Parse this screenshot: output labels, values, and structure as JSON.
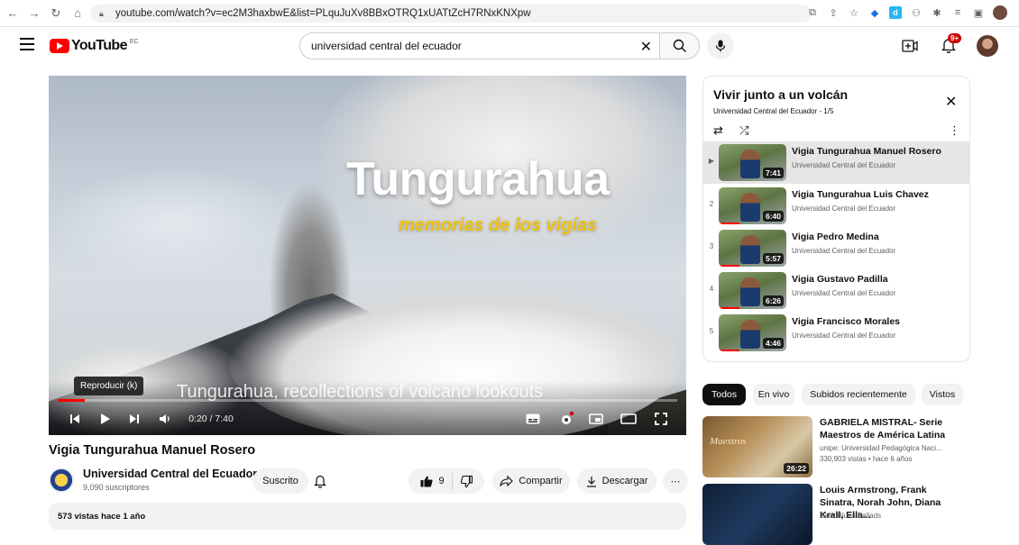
{
  "browser": {
    "url": "youtube.com/watch?v=ec2M3haxbwE&list=PLquJuXv8BBxOTRQ1xUATtZcH7RNxKNXpw"
  },
  "masthead": {
    "logo_text": "YouTube",
    "country": "EC",
    "search_value": "universidad central del ecuador",
    "notif_count": "9+"
  },
  "player": {
    "overlay_title": "Tungurahua",
    "overlay_subtitle": "memorias de los vigías",
    "caption": "Tungurahua, recollections of volcano lookouts",
    "tooltip": "Reproducir (k)",
    "time": "0:20 / 7:40",
    "progress_fraction": 0.043
  },
  "video": {
    "title": "Vigia Tungurahua Manuel Rosero",
    "channel": "Universidad Central del Ecuador",
    "subscribers": "9,090 suscriptores",
    "subscribe_label": "Suscrito",
    "likes": "9",
    "share_label": "Compartir",
    "download_label": "Descargar",
    "description_meta": "573 vistas  hace 1 año"
  },
  "playlist": {
    "title": "Vivir junto a un volcán",
    "subtitle": "Universidad Central del Ecuador - 1/5",
    "items": [
      {
        "index": "▶",
        "title": "Vigia Tungurahua Manuel Rosero",
        "channel": "Universidad Central del Ecuador",
        "duration": "7:41"
      },
      {
        "index": "2",
        "title": "Vigia Tungurahua Luis Chavez",
        "channel": "Universidad Central del Ecuador",
        "duration": "6:40"
      },
      {
        "index": "3",
        "title": "Vigia Pedro Medina",
        "channel": "Universidad Central del Ecuador",
        "duration": "5:57"
      },
      {
        "index": "4",
        "title": "Vigia Gustavo Padilla",
        "channel": "Universidad Central del Ecuador",
        "duration": "6:26"
      },
      {
        "index": "5",
        "title": "Vigia Francisco Morales",
        "channel": "Universidad Central del Ecuador",
        "duration": "4:46"
      }
    ]
  },
  "chips": [
    "Todos",
    "En vivo",
    "Subidos recientemente",
    "Vistos"
  ],
  "recommendations": [
    {
      "title": "GABRIELA MISTRAL- Serie Maestros de América Latina",
      "channel": "unipe: Universidad Pedagógica Naci...",
      "meta": "330,903 vistas  • hace 6 años",
      "duration": "26:22",
      "thumb_text": "Maestros"
    },
    {
      "title": "Louis Armstrong, Frank Sinatra, Norah John, Diana Krall, Ella...",
      "channel": "Slow Blues Ballads",
      "meta": "",
      "duration": "",
      "thumb_text": ""
    }
  ]
}
